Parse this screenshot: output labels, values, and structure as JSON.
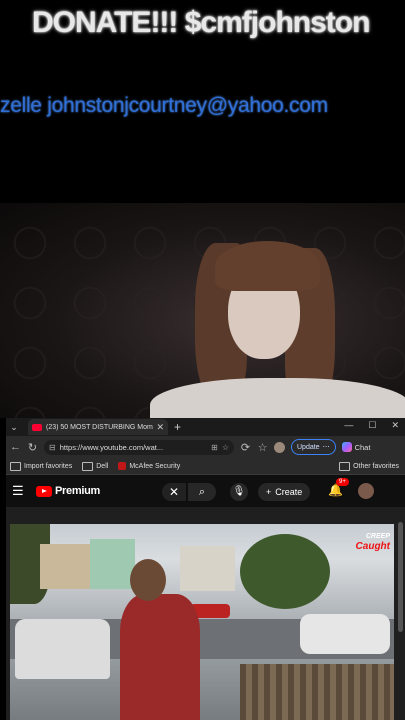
{
  "overlay": {
    "donate_text": "DONATE!!! $cmfjohnston",
    "zelle_text": "zelle johnstonjcourtney@yahoo.com"
  },
  "browser": {
    "tab_title": "(23) 50 MOST DISTURBING Mome",
    "url": "https://www.youtube.com/wat...",
    "update_label": "Update",
    "copilot_label": "Chat",
    "bookmarks": [
      {
        "label": "Import favorites"
      },
      {
        "label": "Dell"
      },
      {
        "label": "McAfee Security"
      }
    ],
    "other_favorites": "Other favorites"
  },
  "youtube": {
    "logo_text": "Premium",
    "create_label": "Create",
    "notification_count": "9+",
    "brand_top": "CREEP",
    "brand_bottom": "Caught"
  },
  "colors": {
    "zelle_blue": "#2f6fd6",
    "yt_red": "#ff0000",
    "update_border": "#3b82f6"
  }
}
